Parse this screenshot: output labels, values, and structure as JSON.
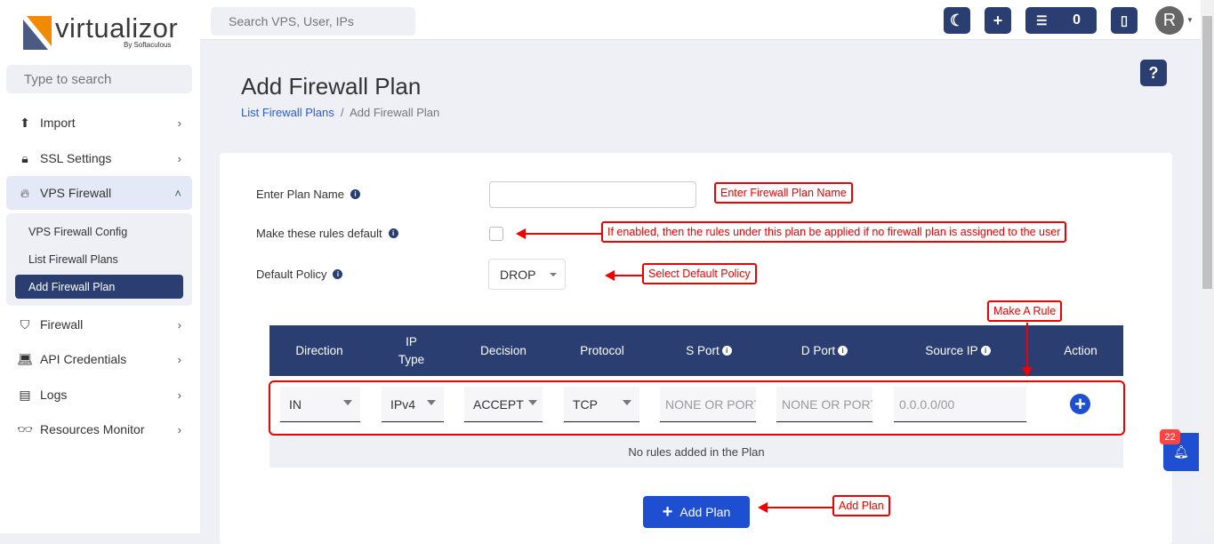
{
  "brand": {
    "name": "virtualizor",
    "tagline": "By Softaculous"
  },
  "sidebar": {
    "search_placeholder": "Type to search",
    "items": [
      {
        "label": "Import",
        "icon": "upload-icon"
      },
      {
        "label": "SSL Settings",
        "icon": "lock-icon"
      },
      {
        "label": "VPS Firewall",
        "icon": "fire-icon",
        "expanded": true
      },
      {
        "label": "Firewall",
        "icon": "shield-icon"
      },
      {
        "label": "API Credentials",
        "icon": "laptop-code-icon"
      },
      {
        "label": "Logs",
        "icon": "file-icon"
      },
      {
        "label": "Resources Monitor",
        "icon": "glasses-icon"
      }
    ],
    "submenu": [
      "VPS Firewall Config",
      "List Firewall Plans",
      "Add Firewall Plan"
    ],
    "active": "Add Firewall Plan"
  },
  "topbar": {
    "search_placeholder": "Search VPS, User, IPs",
    "tasks_count": "0",
    "avatar_initial": "R"
  },
  "page": {
    "title": "Add Firewall Plan",
    "breadcrumb": [
      "List Firewall Plans",
      "Add Firewall Plan"
    ],
    "help": "?"
  },
  "form": {
    "plan_name_label": "Enter Plan Name",
    "plan_name_value": "",
    "default_label": "Make these rules default",
    "default_checked": false,
    "policy_label": "Default Policy",
    "policy_value": "DROP"
  },
  "rules": {
    "headers": [
      "Direction",
      "IP Type",
      "Decision",
      "Protocol",
      "S Port",
      "D Port",
      "Source IP",
      "Action"
    ],
    "row": {
      "direction": "IN",
      "ip_type": "IPv4",
      "decision": "ACCEPT",
      "protocol": "TCP",
      "sport_placeholder": "NONE OR PORT",
      "dport_placeholder": "NONE OR PORT",
      "source_ip_placeholder": "0.0.0.0/00"
    },
    "empty": "No rules added in the Plan"
  },
  "add_plan": "Add Plan",
  "notifications": {
    "count": "22"
  },
  "annotations": {
    "plan_name": "Enter Firewall Plan Name",
    "default": "If enabled, then the rules under this plan be applied if no firewall plan is assigned to the user",
    "policy": "Select Default Policy",
    "rule": "Make A Rule",
    "add": "Add Plan"
  },
  "colors": {
    "primary": "#2a3e72",
    "button": "#1e4fd0",
    "annotation": "#e00000"
  }
}
